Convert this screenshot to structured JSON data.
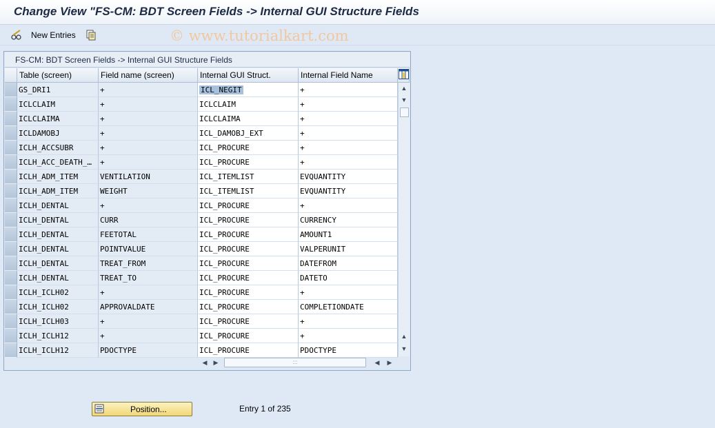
{
  "window": {
    "title": "Change View \"FS-CM: BDT Screen Fields -> Internal GUI Structure Fields"
  },
  "toolbar": {
    "new_entries_label": "New Entries",
    "edit_icon": "pencil-glasses-icon",
    "copy_icon": "copy-icon"
  },
  "watermark": "© www.tutorialkart.com",
  "panel": {
    "title": "FS-CM: BDT Screen Fields -> Internal GUI Structure Fields"
  },
  "table": {
    "columns": [
      "Table (screen)",
      "Field name (screen)",
      "Internal GUI Struct.",
      "Internal Field Name"
    ],
    "rows": [
      [
        "GS_DRI1",
        "+",
        "ICL_NEGIT",
        "+"
      ],
      [
        "ICLCLAIM",
        "+",
        "ICLCLAIM",
        "+"
      ],
      [
        "ICLCLAIMA",
        "+",
        "ICLCLAIMA",
        "+"
      ],
      [
        "ICLDAMOBJ",
        "+",
        "ICL_DAMOBJ_EXT",
        "+"
      ],
      [
        "ICLH_ACCSUBR",
        "+",
        "ICL_PROCURE",
        "+"
      ],
      [
        "ICLH_ACC_DEATH_…",
        "+",
        "ICL_PROCURE",
        "+"
      ],
      [
        "ICLH_ADM_ITEM",
        "VENTILATION",
        "ICL_ITEMLIST",
        "EVQUANTITY"
      ],
      [
        "ICLH_ADM_ITEM",
        "WEIGHT",
        "ICL_ITEMLIST",
        "EVQUANTITY"
      ],
      [
        "ICLH_DENTAL",
        "+",
        "ICL_PROCURE",
        "+"
      ],
      [
        "ICLH_DENTAL",
        "CURR",
        "ICL_PROCURE",
        "CURRENCY"
      ],
      [
        "ICLH_DENTAL",
        "FEETOTAL",
        "ICL_PROCURE",
        "AMOUNT1"
      ],
      [
        "ICLH_DENTAL",
        "POINTVALUE",
        "ICL_PROCURE",
        "VALPERUNIT"
      ],
      [
        "ICLH_DENTAL",
        "TREAT_FROM",
        "ICL_PROCURE",
        "DATEFROM"
      ],
      [
        "ICLH_DENTAL",
        "TREAT_TO",
        "ICL_PROCURE",
        "DATETO"
      ],
      [
        "ICLH_ICLH02",
        "+",
        "ICL_PROCURE",
        "+"
      ],
      [
        "ICLH_ICLH02",
        "APPROVALDATE",
        "ICL_PROCURE",
        "COMPLETIONDATE"
      ],
      [
        "ICLH_ICLH03",
        "+",
        "ICL_PROCURE",
        "+"
      ],
      [
        "ICLH_ICLH12",
        "+",
        "ICL_PROCURE",
        "+"
      ],
      [
        "ICLH_ICLH12",
        "PDOCTYPE",
        "ICL_PROCURE",
        "PDOCTYPE"
      ]
    ],
    "column_settings_icon": "table-settings-icon"
  },
  "footer": {
    "position_button_label": "Position...",
    "entry_info": "Entry 1 of 235"
  },
  "colors": {
    "background": "#dfe9f5",
    "header": "#e8eef6",
    "highlight": "#a7c0de",
    "button": "#f1d776"
  }
}
